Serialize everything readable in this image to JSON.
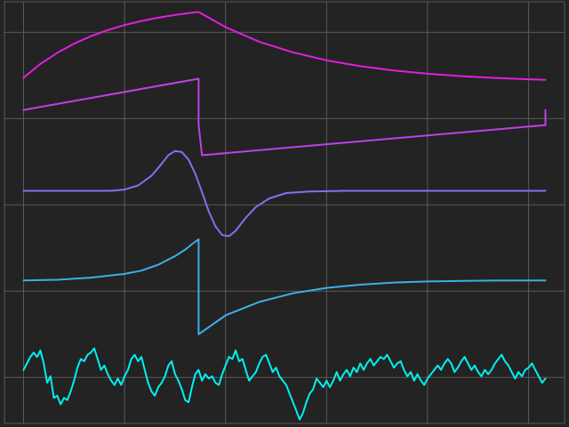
{
  "chart_data": {
    "type": "line",
    "title": "",
    "xlabel": "",
    "ylabel": "",
    "grid": true,
    "legend": "none",
    "colors": {
      "background": "#232323",
      "grid": "#5a5a5a"
    },
    "series": [
      {
        "color": "#e21ee2",
        "points": [
          [
            0,
            0.5
          ],
          [
            0.05,
            1.77
          ],
          [
            0.1,
            2.8
          ],
          [
            0.15,
            3.65
          ],
          [
            0.2,
            4.34
          ],
          [
            0.25,
            4.91
          ],
          [
            0.3,
            5.37
          ],
          [
            0.35,
            5.75
          ],
          [
            0.4,
            6.06
          ],
          [
            0.45,
            6.31
          ],
          [
            0.5,
            6.52
          ],
          [
            0.52,
            6.59
          ],
          [
            0.6,
            5.18
          ],
          [
            0.7,
            3.83
          ],
          [
            0.8,
            2.84
          ],
          [
            0.9,
            2.11
          ],
          [
            1.0,
            1.56
          ],
          [
            1.1,
            1.16
          ],
          [
            1.2,
            0.86
          ],
          [
            1.3,
            0.64
          ],
          [
            1.4,
            0.47
          ],
          [
            1.5,
            0.35
          ],
          [
            1.55,
            0.3
          ]
        ]
      },
      {
        "color": "#bf40e8",
        "points": [
          [
            0,
            -2.5
          ],
          [
            0.52,
            0.4
          ],
          [
            0.52,
            -3.9
          ],
          [
            0.53,
            -6.7
          ],
          [
            1.55,
            -3.9
          ],
          [
            1.55,
            -2.5
          ]
        ]
      },
      {
        "color": "#8a6cf2",
        "points": [
          [
            0,
            -10
          ],
          [
            0.2,
            -10
          ],
          [
            0.26,
            -10
          ],
          [
            0.3,
            -9.88
          ],
          [
            0.34,
            -9.5
          ],
          [
            0.38,
            -8.6
          ],
          [
            0.41,
            -7.5
          ],
          [
            0.43,
            -6.7
          ],
          [
            0.45,
            -6.3
          ],
          [
            0.47,
            -6.4
          ],
          [
            0.49,
            -7.1
          ],
          [
            0.51,
            -8.4
          ],
          [
            0.53,
            -10.1
          ],
          [
            0.55,
            -11.9
          ],
          [
            0.57,
            -13.3
          ],
          [
            0.59,
            -14.1
          ],
          [
            0.61,
            -14.2
          ],
          [
            0.63,
            -13.7
          ],
          [
            0.66,
            -12.5
          ],
          [
            0.69,
            -11.5
          ],
          [
            0.73,
            -10.7
          ],
          [
            0.78,
            -10.2
          ],
          [
            0.85,
            -10.05
          ],
          [
            0.95,
            -10
          ],
          [
            1.55,
            -10
          ]
        ]
      },
      {
        "color": "#3eaee8",
        "points": [
          [
            0,
            -18.3
          ],
          [
            0.1,
            -18.25
          ],
          [
            0.2,
            -18.05
          ],
          [
            0.3,
            -17.7
          ],
          [
            0.35,
            -17.4
          ],
          [
            0.4,
            -16.85
          ],
          [
            0.45,
            -16.05
          ],
          [
            0.48,
            -15.45
          ],
          [
            0.5,
            -14.95
          ],
          [
            0.52,
            -14.5
          ],
          [
            0.52,
            -23.3
          ],
          [
            0.6,
            -21.55
          ],
          [
            0.7,
            -20.3
          ],
          [
            0.8,
            -19.5
          ],
          [
            0.9,
            -19.0
          ],
          [
            1.0,
            -18.7
          ],
          [
            1.1,
            -18.5
          ],
          [
            1.2,
            -18.4
          ],
          [
            1.3,
            -18.35
          ],
          [
            1.4,
            -18.32
          ],
          [
            1.55,
            -18.3
          ]
        ]
      },
      {
        "color": "#00f0f0",
        "points": [
          [
            0.0,
            -26.6
          ],
          [
            0.01,
            -26.0
          ],
          [
            0.02,
            -25.4
          ],
          [
            0.03,
            -25.0
          ],
          [
            0.04,
            -25.4
          ],
          [
            0.05,
            -24.8
          ],
          [
            0.06,
            -26.0
          ],
          [
            0.07,
            -27.8
          ],
          [
            0.08,
            -27.2
          ],
          [
            0.09,
            -29.2
          ],
          [
            0.1,
            -29.0
          ],
          [
            0.11,
            -29.8
          ],
          [
            0.12,
            -29.2
          ],
          [
            0.13,
            -29.4
          ],
          [
            0.14,
            -28.6
          ],
          [
            0.15,
            -27.6
          ],
          [
            0.16,
            -26.4
          ],
          [
            0.17,
            -25.6
          ],
          [
            0.18,
            -25.8
          ],
          [
            0.19,
            -25.2
          ],
          [
            0.2,
            -25.0
          ],
          [
            0.21,
            -24.6
          ],
          [
            0.22,
            -25.6
          ],
          [
            0.23,
            -26.6
          ],
          [
            0.24,
            -26.2
          ],
          [
            0.25,
            -27.0
          ],
          [
            0.26,
            -27.6
          ],
          [
            0.27,
            -28.0
          ],
          [
            0.28,
            -27.4
          ],
          [
            0.29,
            -28.0
          ],
          [
            0.3,
            -27.2
          ],
          [
            0.31,
            -26.6
          ],
          [
            0.32,
            -25.6
          ],
          [
            0.33,
            -25.2
          ],
          [
            0.34,
            -25.8
          ],
          [
            0.35,
            -25.4
          ],
          [
            0.36,
            -26.6
          ],
          [
            0.37,
            -27.8
          ],
          [
            0.38,
            -28.6
          ],
          [
            0.39,
            -29.0
          ],
          [
            0.4,
            -28.2
          ],
          [
            0.41,
            -27.8
          ],
          [
            0.42,
            -27.2
          ],
          [
            0.43,
            -26.2
          ],
          [
            0.44,
            -25.8
          ],
          [
            0.45,
            -27.0
          ],
          [
            0.46,
            -27.6
          ],
          [
            0.47,
            -28.4
          ],
          [
            0.48,
            -29.4
          ],
          [
            0.49,
            -29.6
          ],
          [
            0.5,
            -28.2
          ],
          [
            0.51,
            -27.0
          ],
          [
            0.52,
            -26.6
          ],
          [
            0.53,
            -27.6
          ],
          [
            0.54,
            -27.0
          ],
          [
            0.55,
            -27.4
          ],
          [
            0.56,
            -27.2
          ],
          [
            0.57,
            -27.8
          ],
          [
            0.58,
            -28.0
          ],
          [
            0.59,
            -27.0
          ],
          [
            0.6,
            -26.2
          ],
          [
            0.61,
            -25.4
          ],
          [
            0.62,
            -25.6
          ],
          [
            0.63,
            -24.8
          ],
          [
            0.64,
            -25.8
          ],
          [
            0.65,
            -25.6
          ],
          [
            0.66,
            -26.6
          ],
          [
            0.67,
            -27.6
          ],
          [
            0.68,
            -27.2
          ],
          [
            0.69,
            -26.8
          ],
          [
            0.7,
            -26.0
          ],
          [
            0.71,
            -25.4
          ],
          [
            0.72,
            -25.2
          ],
          [
            0.73,
            -26.0
          ],
          [
            0.74,
            -26.8
          ],
          [
            0.75,
            -26.4
          ],
          [
            0.76,
            -27.2
          ],
          [
            0.77,
            -27.6
          ],
          [
            0.78,
            -28.0
          ],
          [
            0.79,
            -28.8
          ],
          [
            0.8,
            -29.6
          ],
          [
            0.81,
            -30.4
          ],
          [
            0.82,
            -31.2
          ],
          [
            0.83,
            -30.6
          ],
          [
            0.84,
            -29.6
          ],
          [
            0.85,
            -28.8
          ],
          [
            0.86,
            -28.4
          ],
          [
            0.87,
            -27.4
          ],
          [
            0.88,
            -27.8
          ],
          [
            0.89,
            -28.2
          ],
          [
            0.9,
            -27.6
          ],
          [
            0.91,
            -28.2
          ],
          [
            0.92,
            -27.6
          ],
          [
            0.93,
            -26.8
          ],
          [
            0.94,
            -27.6
          ],
          [
            0.95,
            -27.0
          ],
          [
            0.96,
            -26.6
          ],
          [
            0.97,
            -27.2
          ],
          [
            0.98,
            -26.4
          ],
          [
            0.99,
            -26.8
          ],
          [
            1.0,
            -26.0
          ],
          [
            1.01,
            -26.6
          ],
          [
            1.02,
            -26.0
          ],
          [
            1.03,
            -25.6
          ],
          [
            1.04,
            -26.2
          ],
          [
            1.05,
            -25.8
          ],
          [
            1.06,
            -25.4
          ],
          [
            1.07,
            -25.6
          ],
          [
            1.08,
            -25.2
          ],
          [
            1.09,
            -25.8
          ],
          [
            1.1,
            -26.4
          ],
          [
            1.11,
            -26.0
          ],
          [
            1.12,
            -25.8
          ],
          [
            1.13,
            -26.6
          ],
          [
            1.14,
            -27.2
          ],
          [
            1.15,
            -26.8
          ],
          [
            1.16,
            -27.6
          ],
          [
            1.17,
            -27.0
          ],
          [
            1.18,
            -27.6
          ],
          [
            1.19,
            -28.0
          ],
          [
            1.2,
            -27.4
          ],
          [
            1.21,
            -27.0
          ],
          [
            1.22,
            -26.6
          ],
          [
            1.23,
            -26.2
          ],
          [
            1.24,
            -26.6
          ],
          [
            1.25,
            -26.0
          ],
          [
            1.26,
            -25.6
          ],
          [
            1.27,
            -26.0
          ],
          [
            1.28,
            -26.8
          ],
          [
            1.29,
            -26.4
          ],
          [
            1.3,
            -25.8
          ],
          [
            1.31,
            -25.4
          ],
          [
            1.32,
            -26.0
          ],
          [
            1.33,
            -26.6
          ],
          [
            1.34,
            -26.2
          ],
          [
            1.35,
            -26.8
          ],
          [
            1.36,
            -27.2
          ],
          [
            1.37,
            -26.6
          ],
          [
            1.38,
            -27.0
          ],
          [
            1.39,
            -26.6
          ],
          [
            1.4,
            -26.0
          ],
          [
            1.41,
            -25.6
          ],
          [
            1.42,
            -25.2
          ],
          [
            1.43,
            -25.8
          ],
          [
            1.44,
            -26.2
          ],
          [
            1.45,
            -26.8
          ],
          [
            1.46,
            -27.4
          ],
          [
            1.47,
            -26.8
          ],
          [
            1.48,
            -27.2
          ],
          [
            1.49,
            -26.6
          ],
          [
            1.5,
            -26.4
          ],
          [
            1.51,
            -26.0
          ],
          [
            1.52,
            -26.6
          ],
          [
            1.53,
            -27.2
          ],
          [
            1.54,
            -27.8
          ],
          [
            1.55,
            -27.4
          ]
        ]
      }
    ],
    "xlim": [
      -0.07,
      1.62
    ],
    "ylim": [
      -31.9,
      7.7
    ],
    "x_gridlines": [
      0,
      0.3,
      0.6,
      0.9,
      1.2,
      1.5
    ],
    "y_gridlines": [
      -27.3,
      -19.3,
      -11.3,
      -3.3,
      4.7
    ]
  }
}
